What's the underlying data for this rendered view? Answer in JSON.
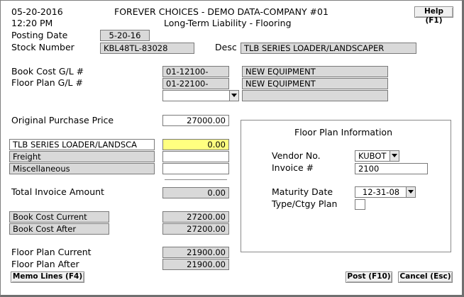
{
  "header": {
    "date": "05-20-2016",
    "time": "12:20 PM",
    "company": "FOREVER CHOICES - DEMO DATA-COMPANY #01",
    "screen_title": "Long-Term Liability - Flooring",
    "help_label": "Help (F1)"
  },
  "posting": {
    "label": "Posting Date",
    "value": "5-20-16"
  },
  "stock": {
    "label": "Stock Number",
    "value": "KBL48TL-83028",
    "desc_label": "Desc",
    "desc_value": "TLB SERIES LOADER/LANDSCAPER"
  },
  "gl": {
    "book_cost_label": "Book Cost G/L #",
    "book_cost_value": "01-12100-",
    "book_cost_desc": "NEW EQUIPMENT",
    "floor_plan_label": "Floor Plan G/L #",
    "floor_plan_value": "01-22100-",
    "floor_plan_desc": "NEW EQUIPMENT",
    "extra_value": "",
    "extra_desc": ""
  },
  "purchase": {
    "original_label": "Original Purchase Price",
    "original_value": "27000.00",
    "line1_label": "TLB SERIES LOADER/LANDSCA",
    "line1_value": "0.00",
    "freight_label": "Freight",
    "freight_value": "",
    "misc_label": "Miscellaneous",
    "misc_value": "",
    "total_label": "Total Invoice Amount",
    "total_value": "0.00"
  },
  "book_cost": {
    "current_label": "Book Cost Current",
    "current_value": "27200.00",
    "after_label": "Book Cost After",
    "after_value": "27200.00"
  },
  "floor_plan": {
    "current_label": "Floor Plan Current",
    "current_value": "21900.00",
    "after_label": "Floor Plan After",
    "after_value": "21900.00"
  },
  "floor_plan_info": {
    "title": "Floor Plan Information",
    "vendor_label": "Vendor No.",
    "vendor_value": "KUBOT",
    "invoice_label": "Invoice #",
    "invoice_value": "2100",
    "maturity_label": "Maturity Date",
    "maturity_value": "12-31-08",
    "type_label": "Type/Ctgy Plan"
  },
  "buttons": {
    "memo": "Memo Lines (F4)",
    "post": "Post (F10)",
    "cancel": "Cancel (Esc)"
  }
}
